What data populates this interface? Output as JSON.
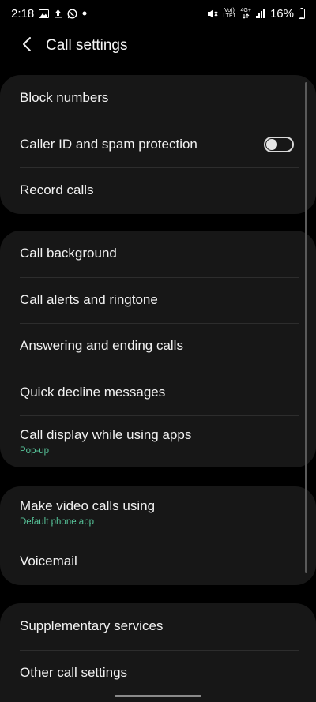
{
  "status_bar": {
    "time": "2:18",
    "battery": "16%",
    "icons_left": [
      "image-icon",
      "upload-icon",
      "whatsapp-icon",
      "dot-icon"
    ],
    "icons_right": [
      "mute-vibrate-icon",
      "volte-icon",
      "4g-icon",
      "signal-icon",
      "battery-icon"
    ],
    "volte_line1": "Vo))",
    "volte_line2": "LTE1",
    "net_label": "4G+"
  },
  "header": {
    "title": "Call settings",
    "back_icon": "chevron-left-icon"
  },
  "groups": [
    {
      "items": [
        {
          "label": "Block numbers"
        },
        {
          "label": "Caller ID and spam protection",
          "toggle": false
        },
        {
          "label": "Record calls"
        }
      ]
    },
    {
      "items": [
        {
          "label": "Call background"
        },
        {
          "label": "Call alerts and ringtone"
        },
        {
          "label": "Answering and ending calls"
        },
        {
          "label": "Quick decline messages"
        },
        {
          "label": "Call display while using apps",
          "sublabel": "Pop-up"
        }
      ]
    },
    {
      "items": [
        {
          "label": "Make video calls using",
          "sublabel": "Default phone app"
        },
        {
          "label": "Voicemail"
        }
      ]
    },
    {
      "items": [
        {
          "label": "Supplementary services"
        },
        {
          "label": "Other call settings"
        }
      ]
    }
  ],
  "colors": {
    "background": "#000000",
    "card": "#171717",
    "accent_sublabel": "#57c49a"
  }
}
